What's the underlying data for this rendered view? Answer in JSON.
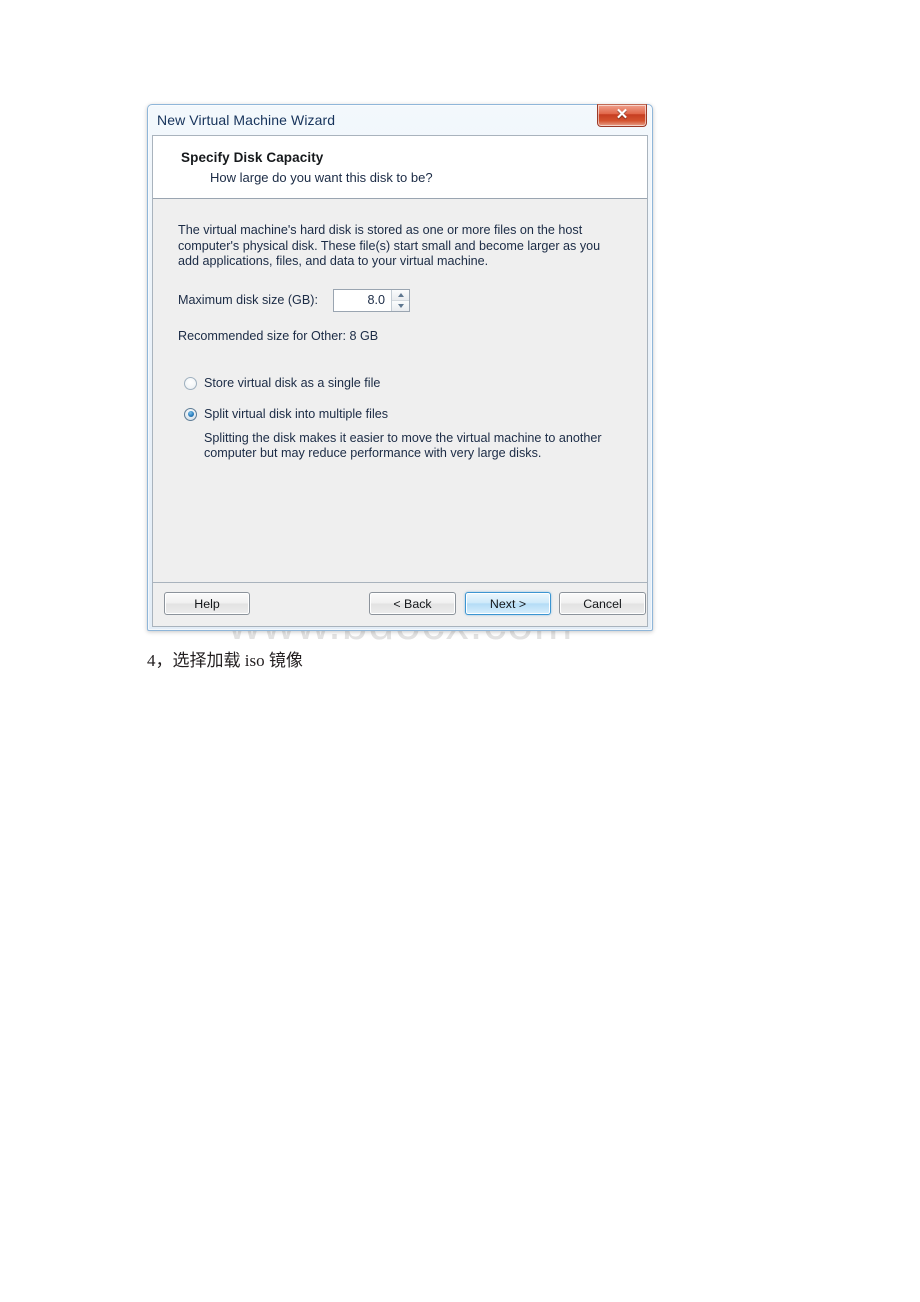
{
  "page": {
    "watermark": "www.bdocx.com",
    "caption": "4，选择加载 iso 镜像"
  },
  "dialog": {
    "title": "New Virtual Machine Wizard",
    "close_icon": "close-icon",
    "close_glyph": "✕",
    "header": {
      "title": "Specify Disk Capacity",
      "subtitle": "How large do you want this disk to be?"
    },
    "body": {
      "description": "The virtual machine's hard disk is stored as one or more files on the host computer's physical disk. These file(s) start small and become larger as you add applications, files, and data to your virtual machine.",
      "disk_size_label": "Maximum disk size (GB):",
      "disk_size_value": "8.0",
      "spinner_up_icon": "arrow-up-icon",
      "spinner_down_icon": "arrow-down-icon",
      "recommended": "Recommended size for Other: 8 GB",
      "options": [
        {
          "label": "Store virtual disk as a single file",
          "selected": false,
          "help": ""
        },
        {
          "label": "Split virtual disk into multiple files",
          "selected": true,
          "help": "Splitting the disk makes it easier to move the virtual machine to another computer but may reduce performance with very large disks."
        }
      ]
    },
    "buttons": {
      "help": "Help",
      "back": "< Back",
      "next": "Next >",
      "cancel": "Cancel"
    },
    "colors": {
      "titlebar_text": "#16335b",
      "close_red": "#c63d21",
      "default_button_border": "#3c95d1",
      "radio_dot": "#2b7fc0",
      "client_background": "#efefef",
      "header_background": "#ffffff"
    }
  }
}
